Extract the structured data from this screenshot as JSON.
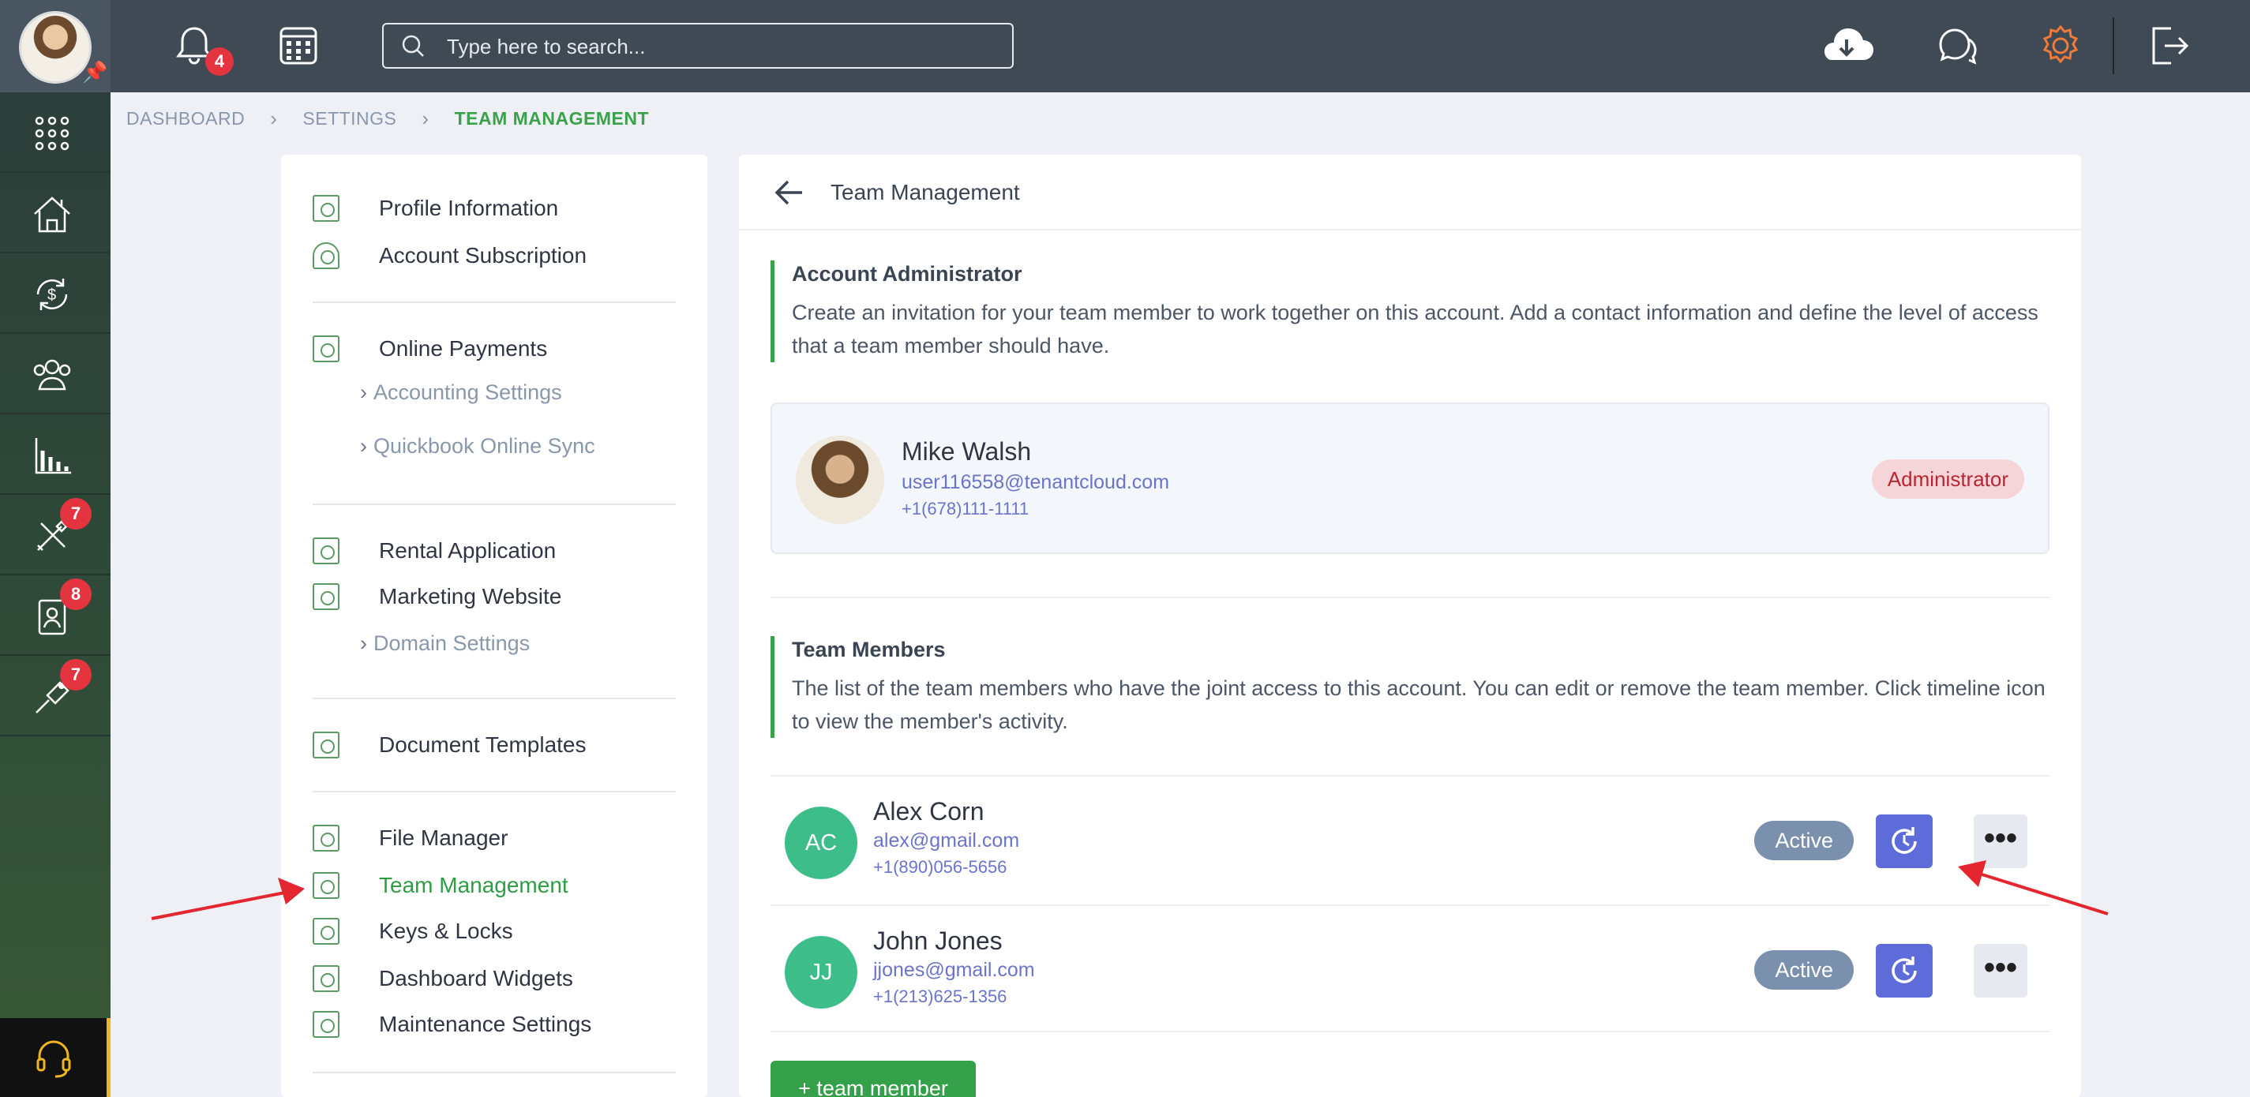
{
  "topbar": {
    "notifications_count": "4",
    "search_placeholder": "Type here to search..."
  },
  "leftnav": {
    "badges": {
      "maintenance": "7",
      "tenants": "8",
      "tools": "7"
    }
  },
  "breadcrumb": {
    "items": [
      "DASHBOARD",
      "SETTINGS",
      "TEAM MANAGEMENT"
    ]
  },
  "settings_menu": {
    "items": [
      "Profile Information",
      "Account Subscription",
      "Online Payments",
      "Accounting Settings",
      "Quickbook Online Sync",
      "Rental Application",
      "Marketing Website",
      "Domain Settings",
      "Document Templates",
      "File Manager",
      "Team Management",
      "Keys & Locks",
      "Dashboard Widgets",
      "Maintenance Settings"
    ]
  },
  "main": {
    "title": "Team Management",
    "admin_section": {
      "title": "Account Administrator",
      "description": "Create an invitation for your team member to work together on this account. Add a contact information and define the level of access that a team member should have."
    },
    "admin": {
      "name": "Mike Walsh",
      "email": "user116558@tenantcloud.com",
      "phone": "+1(678)111-1111",
      "role": "Administrator"
    },
    "members_section": {
      "title": "Team Members",
      "description": "The list of the team members who have the joint access to this account. You can edit or remove the team member. Click timeline icon to view the member's activity."
    },
    "members": [
      {
        "initials": "AC",
        "name": "Alex Corn",
        "email": "alex@gmail.com",
        "phone": "+1(890)056-5656",
        "status": "Active"
      },
      {
        "initials": "JJ",
        "name": "John Jones",
        "email": "jjones@gmail.com",
        "phone": "+1(213)625-1356",
        "status": "Active"
      }
    ],
    "add_button": "+ team member",
    "more_glyph": "•••"
  },
  "colors": {
    "topbar": "#3f4a55",
    "accent_green": "#3aa24a",
    "timeline_button": "#5d6cd8",
    "status_badge": "#7b90ad",
    "admin_role_bg": "#f6d5d8",
    "annotation_arrow": "#e3262f"
  },
  "icons": {
    "topbar": [
      "bell-icon",
      "calendar-icon",
      "search-icon",
      "cloud-download-icon",
      "chat-icon",
      "gear-icon",
      "logout-icon"
    ],
    "leftnav": [
      "apps-grid-icon",
      "properties-icon",
      "accounting-icon",
      "people-icon",
      "reports-icon",
      "maintenance-icon",
      "tenants-icon",
      "tools-icon",
      "headset-icon"
    ]
  }
}
